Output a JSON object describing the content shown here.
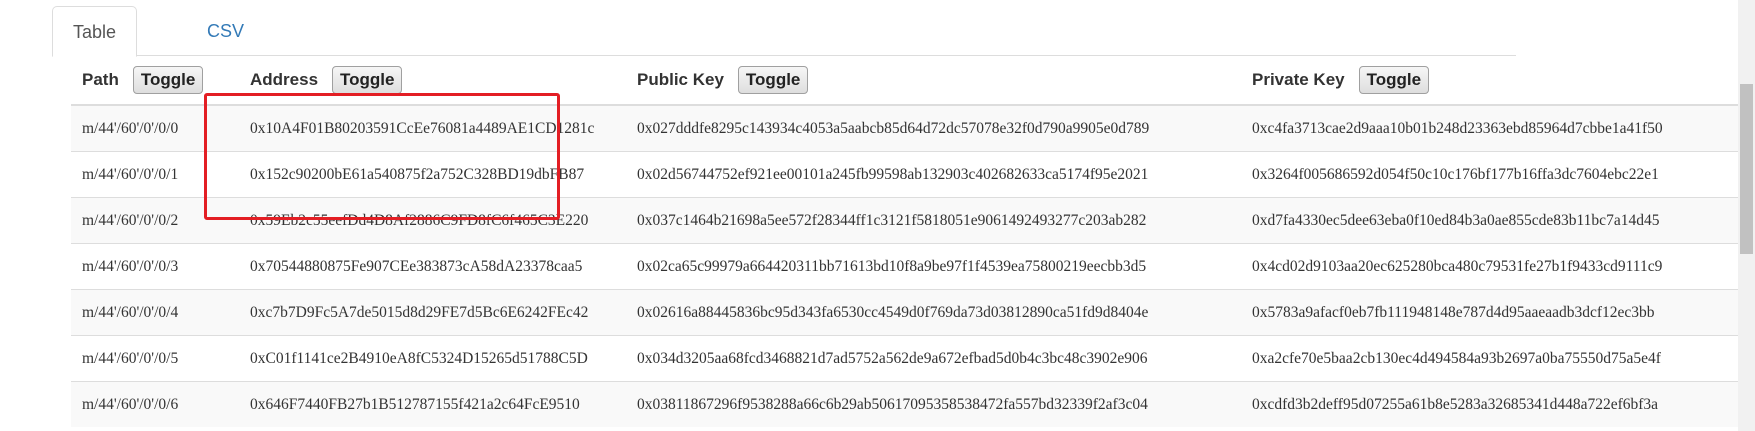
{
  "tabs": [
    {
      "label": "Table",
      "active": true
    },
    {
      "label": "CSV",
      "active": false
    }
  ],
  "table": {
    "toggle_label": "Toggle",
    "headers": {
      "path": "Path",
      "address": "Address",
      "public_key": "Public Key",
      "private_key": "Private Key"
    },
    "rows": [
      {
        "path": "m/44'/60'/0'/0/0",
        "address": "0x10A4F01B80203591CcEe76081a4489AE1CD1281c",
        "public_key": "0x027dddfe8295c143934c4053a5aabcb85d64d72dc57078e32f0d790a9905e0d789",
        "private_key": "0xc4fa3713cae2d9aaa10b01b248d23363ebd85964d7cbbe1a41f50"
      },
      {
        "path": "m/44'/60'/0'/0/1",
        "address": "0x152c90200bE61a540875f2a752C328BD19dbFB87",
        "public_key": "0x02d56744752ef921ee00101a245fb99598ab132903c402682633ca5174f95e2021",
        "private_key": "0x3264f005686592d054f50c10c176bf177b16ffa3dc7604ebc22e1"
      },
      {
        "path": "m/44'/60'/0'/0/2",
        "address": "0x59Eb2c55eefDd4D8Af2886C9FD8fC6f465C3E220",
        "public_key": "0x037c1464b21698a5ee572f28344ff1c3121f5818051e9061492493277c203ab282",
        "private_key": "0xd7fa4330ec5dee63eba0f10ed84b3a0ae855cde83b11bc7a14d45"
      },
      {
        "path": "m/44'/60'/0'/0/3",
        "address": "0x70544880875Fe907CEe383873cA58dA23378caa5",
        "public_key": "0x02ca65c99979a664420311bb71613bd10f8a9be97f1f4539ea75800219eecbb3d5",
        "private_key": "0x4cd02d9103aa20ec625280bca480c79531fe27b1f9433cd9111c9"
      },
      {
        "path": "m/44'/60'/0'/0/4",
        "address": "0xc7b7D9Fc5A7de5015d8d29FE7d5Bc6E6242FEc42",
        "public_key": "0x02616a88445836bc95d343fa6530cc4549d0f769da73d03812890ca51fd9d8404e",
        "private_key": "0x5783a9afacf0eb7fb111948148e787d4d95aaeaadb3dcf12ec3bb"
      },
      {
        "path": "m/44'/60'/0'/0/5",
        "address": "0xC01f1141ce2B4910eA8fC5324D15265d51788C5D",
        "public_key": "0x034d3205aa68fcd3468821d7ad5752a562de9a672efbad5d0b4c3bc48c3902e906",
        "private_key": "0xa2cfe70e5baa2cb130ec4d494584a93b2697a0ba75550d75a5e4f"
      },
      {
        "path": "m/44'/60'/0'/0/6",
        "address": "0x646F7440FB27b1B512787155f421a2c64FcE9510",
        "public_key": "0x03811867296f9538288a66c6b29ab50617095358538472fa557bd32339f2af3c04",
        "private_key": "0xcdfd3b2deff95d07255a61b8e5283a32685341d448a722ef6bf3a"
      }
    ]
  }
}
